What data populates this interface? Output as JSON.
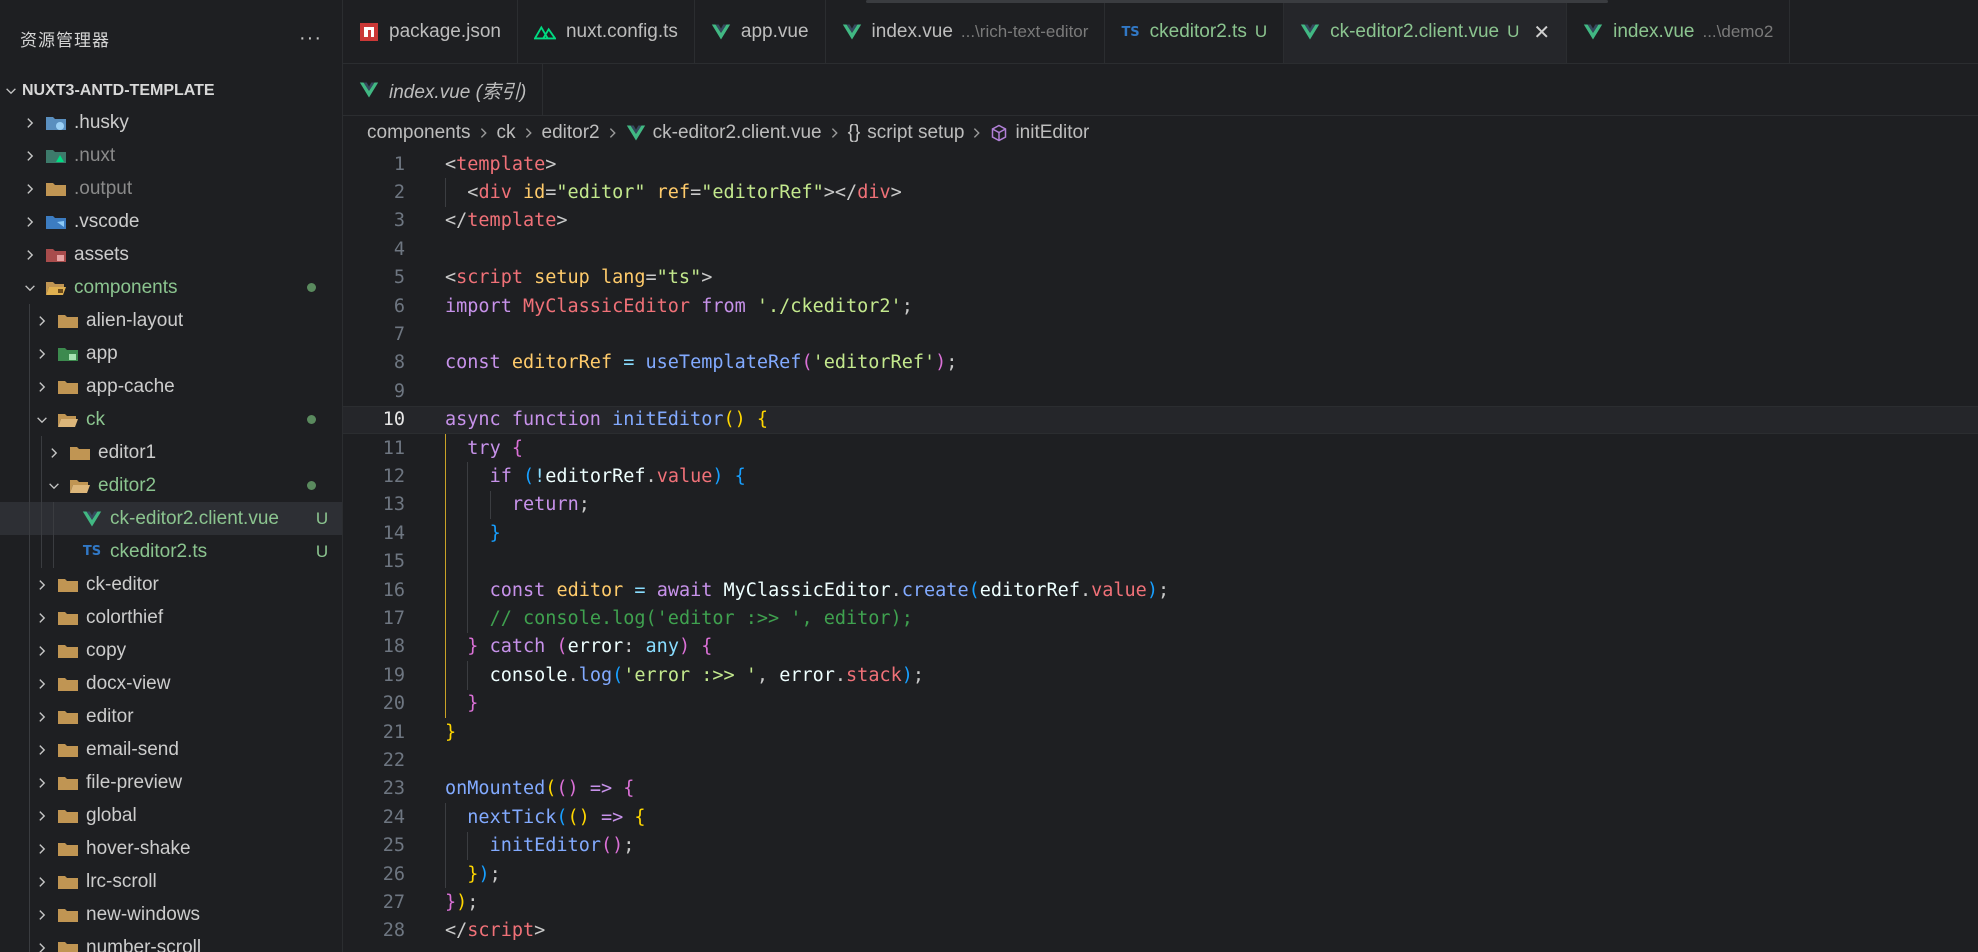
{
  "sidebar": {
    "title": "资源管理器",
    "more": "···",
    "project": "NUXT3-ANTD-TEMPLATE",
    "items": [
      {
        "label": ".husky",
        "depth": 0,
        "open": false,
        "icon": "husky-folder-icon",
        "style": ""
      },
      {
        "label": ".nuxt",
        "depth": 0,
        "open": false,
        "icon": "nuxt-folder-icon",
        "style": "dim"
      },
      {
        "label": ".output",
        "depth": 0,
        "open": false,
        "icon": "folder-icon",
        "style": "dim"
      },
      {
        "label": ".vscode",
        "depth": 0,
        "open": false,
        "icon": "vscode-folder-icon",
        "style": ""
      },
      {
        "label": "assets",
        "depth": 0,
        "open": false,
        "icon": "assets-folder-icon",
        "style": ""
      },
      {
        "label": "components",
        "depth": 0,
        "open": true,
        "icon": "components-folder-icon",
        "style": "git",
        "dot": true
      },
      {
        "label": "alien-layout",
        "depth": 1,
        "open": false,
        "icon": "folder-icon",
        "style": ""
      },
      {
        "label": "app",
        "depth": 1,
        "open": false,
        "icon": "app-folder-icon",
        "style": ""
      },
      {
        "label": "app-cache",
        "depth": 1,
        "open": false,
        "icon": "folder-icon",
        "style": ""
      },
      {
        "label": "ck",
        "depth": 1,
        "open": true,
        "icon": "folder-open-icon",
        "style": "git",
        "dot": true
      },
      {
        "label": "editor1",
        "depth": 2,
        "open": false,
        "icon": "folder-icon",
        "style": ""
      },
      {
        "label": "editor2",
        "depth": 2,
        "open": true,
        "icon": "folder-open-icon",
        "style": "git",
        "dot": true
      },
      {
        "label": "ck-editor2.client.vue",
        "depth": 3,
        "file": true,
        "icon": "vue-file-icon",
        "style": "git",
        "badge": "U",
        "selected": true
      },
      {
        "label": "ckeditor2.ts",
        "depth": 3,
        "file": true,
        "icon": "ts-file-icon",
        "style": "git",
        "badge": "U"
      },
      {
        "label": "ck-editor",
        "depth": 1,
        "open": false,
        "icon": "folder-icon",
        "style": ""
      },
      {
        "label": "colorthief",
        "depth": 1,
        "open": false,
        "icon": "folder-icon",
        "style": ""
      },
      {
        "label": "copy",
        "depth": 1,
        "open": false,
        "icon": "folder-icon",
        "style": ""
      },
      {
        "label": "docx-view",
        "depth": 1,
        "open": false,
        "icon": "folder-icon",
        "style": ""
      },
      {
        "label": "editor",
        "depth": 1,
        "open": false,
        "icon": "folder-icon",
        "style": ""
      },
      {
        "label": "email-send",
        "depth": 1,
        "open": false,
        "icon": "folder-icon",
        "style": ""
      },
      {
        "label": "file-preview",
        "depth": 1,
        "open": false,
        "icon": "folder-icon",
        "style": ""
      },
      {
        "label": "global",
        "depth": 1,
        "open": false,
        "icon": "folder-icon",
        "style": ""
      },
      {
        "label": "hover-shake",
        "depth": 1,
        "open": false,
        "icon": "folder-icon",
        "style": ""
      },
      {
        "label": "lrc-scroll",
        "depth": 1,
        "open": false,
        "icon": "folder-icon",
        "style": ""
      },
      {
        "label": "new-windows",
        "depth": 1,
        "open": false,
        "icon": "folder-icon",
        "style": ""
      },
      {
        "label": "number-scroll",
        "depth": 1,
        "open": false,
        "icon": "folder-icon",
        "style": ""
      }
    ]
  },
  "tabs": [
    {
      "label": "package.json",
      "icon": "npm-icon",
      "desc": "",
      "badge": "",
      "git": false
    },
    {
      "label": "nuxt.config.ts",
      "icon": "nuxt-icon",
      "desc": "",
      "badge": "",
      "git": false
    },
    {
      "label": "app.vue",
      "icon": "vue-file-icon",
      "desc": "",
      "badge": "",
      "git": false
    },
    {
      "label": "index.vue",
      "icon": "vue-file-icon",
      "desc": "...\\rich-text-editor",
      "badge": "",
      "git": false
    },
    {
      "label": "ckeditor2.ts",
      "icon": "ts-file-icon",
      "desc": "",
      "badge": "U",
      "git": true
    },
    {
      "label": "ck-editor2.client.vue",
      "icon": "vue-file-icon",
      "desc": "",
      "badge": "U",
      "git": true,
      "active": true,
      "close": "✕"
    },
    {
      "label": "index.vue",
      "icon": "vue-file-icon",
      "desc": "...\\demo2",
      "badge": "",
      "git": true
    }
  ],
  "tabs_row2": [
    {
      "label": "index.vue (索引)",
      "icon": "vue-file-icon"
    }
  ],
  "breadcrumb": [
    {
      "label": "components",
      "icon": ""
    },
    {
      "label": "ck",
      "icon": ""
    },
    {
      "label": "editor2",
      "icon": ""
    },
    {
      "label": "ck-editor2.client.vue",
      "icon": "vue-file-icon"
    },
    {
      "label": "script setup",
      "icon": "braces-icon",
      "icon_text": "{}"
    },
    {
      "label": "initEditor",
      "icon": "method-icon"
    }
  ],
  "editor": {
    "current_line": 10,
    "lines": [
      {
        "n": "1",
        "indent": 0,
        "tokens": [
          [
            "punc",
            "<"
          ],
          [
            "tag",
            "template"
          ],
          [
            "punc",
            ">"
          ]
        ]
      },
      {
        "n": "2",
        "indent": 1,
        "tokens": [
          [
            "punc",
            "<"
          ],
          [
            "tag",
            "div"
          ],
          [
            "plain",
            " "
          ],
          [
            "attr",
            "id"
          ],
          [
            "punc",
            "="
          ],
          [
            "str",
            "\"editor\""
          ],
          [
            "plain",
            " "
          ],
          [
            "attr",
            "ref"
          ],
          [
            "punc",
            "="
          ],
          [
            "str",
            "\"editorRef\""
          ],
          [
            "punc",
            "></"
          ],
          [
            "tag",
            "div"
          ],
          [
            "punc",
            ">"
          ]
        ]
      },
      {
        "n": "3",
        "indent": 0,
        "tokens": [
          [
            "punc",
            "</"
          ],
          [
            "tag",
            "template"
          ],
          [
            "punc",
            ">"
          ]
        ]
      },
      {
        "n": "4",
        "indent": 0,
        "tokens": []
      },
      {
        "n": "5",
        "indent": 0,
        "tokens": [
          [
            "punc",
            "<"
          ],
          [
            "tag",
            "script"
          ],
          [
            "plain",
            " "
          ],
          [
            "attr",
            "setup"
          ],
          [
            "plain",
            " "
          ],
          [
            "attr",
            "lang"
          ],
          [
            "punc",
            "="
          ],
          [
            "str",
            "\"ts\""
          ],
          [
            "punc",
            ">"
          ]
        ]
      },
      {
        "n": "6",
        "indent": 0,
        "tokens": [
          [
            "kw",
            "import"
          ],
          [
            "plain",
            " "
          ],
          [
            "cls",
            "MyClassicEditor"
          ],
          [
            "plain",
            " "
          ],
          [
            "kw",
            "from"
          ],
          [
            "plain",
            " "
          ],
          [
            "str",
            "'./ckeditor2'"
          ],
          [
            "punc",
            ";"
          ]
        ]
      },
      {
        "n": "7",
        "indent": 0,
        "tokens": []
      },
      {
        "n": "8",
        "indent": 0,
        "tokens": [
          [
            "kw",
            "const"
          ],
          [
            "plain",
            " "
          ],
          [
            "var",
            "editorRef"
          ],
          [
            "plain",
            " "
          ],
          [
            "op",
            "="
          ],
          [
            "plain",
            " "
          ],
          [
            "fn",
            "useTemplateRef"
          ],
          [
            "br2",
            "("
          ],
          [
            "str",
            "'editorRef'"
          ],
          [
            "br2",
            ")"
          ],
          [
            "punc",
            ";"
          ]
        ]
      },
      {
        "n": "9",
        "indent": 0,
        "tokens": []
      },
      {
        "n": "10",
        "indent": 0,
        "tokens": [
          [
            "kw",
            "async"
          ],
          [
            "plain",
            " "
          ],
          [
            "kw",
            "function"
          ],
          [
            "plain",
            " "
          ],
          [
            "fn",
            "initEditor"
          ],
          [
            "br1",
            "()"
          ],
          [
            "plain",
            " "
          ],
          [
            "br1",
            "{"
          ]
        ]
      },
      {
        "n": "11",
        "indent": 1,
        "tokens": [
          [
            "kw",
            "try"
          ],
          [
            "plain",
            " "
          ],
          [
            "br2",
            "{"
          ]
        ]
      },
      {
        "n": "12",
        "indent": 2,
        "tokens": [
          [
            "kw",
            "if"
          ],
          [
            "plain",
            " "
          ],
          [
            "br3",
            "("
          ],
          [
            "op",
            "!"
          ],
          [
            "plain",
            "editorRef"
          ],
          [
            "punc",
            "."
          ],
          [
            "prop",
            "value"
          ],
          [
            "br3",
            ")"
          ],
          [
            "plain",
            " "
          ],
          [
            "br3",
            "{"
          ]
        ]
      },
      {
        "n": "13",
        "indent": 3,
        "tokens": [
          [
            "kw",
            "return"
          ],
          [
            "punc",
            ";"
          ]
        ]
      },
      {
        "n": "14",
        "indent": 2,
        "tokens": [
          [
            "br3",
            "}"
          ]
        ]
      },
      {
        "n": "15",
        "indent": 0,
        "tokens": []
      },
      {
        "n": "16",
        "indent": 2,
        "tokens": [
          [
            "kw",
            "const"
          ],
          [
            "plain",
            " "
          ],
          [
            "var",
            "editor"
          ],
          [
            "plain",
            " "
          ],
          [
            "op",
            "="
          ],
          [
            "plain",
            " "
          ],
          [
            "kw",
            "await"
          ],
          [
            "plain",
            " "
          ],
          [
            "plain",
            "MyClassicEditor"
          ],
          [
            "punc",
            "."
          ],
          [
            "fn",
            "create"
          ],
          [
            "br3",
            "("
          ],
          [
            "plain",
            "editorRef"
          ],
          [
            "punc",
            "."
          ],
          [
            "prop",
            "value"
          ],
          [
            "br3",
            ")"
          ],
          [
            "punc",
            ";"
          ]
        ]
      },
      {
        "n": "17",
        "indent": 2,
        "tokens": [
          [
            "cmt",
            "// console.log('editor :>> ', editor);"
          ]
        ]
      },
      {
        "n": "18",
        "indent": 1,
        "tokens": [
          [
            "br2",
            "}"
          ],
          [
            "plain",
            " "
          ],
          [
            "kw",
            "catch"
          ],
          [
            "plain",
            " "
          ],
          [
            "br2",
            "("
          ],
          [
            "plain",
            "error"
          ],
          [
            "punc",
            ": "
          ],
          [
            "type",
            "any"
          ],
          [
            "br2",
            ")"
          ],
          [
            "plain",
            " "
          ],
          [
            "br2",
            "{"
          ]
        ]
      },
      {
        "n": "19",
        "indent": 2,
        "tokens": [
          [
            "plain",
            "console"
          ],
          [
            "punc",
            "."
          ],
          [
            "fn",
            "log"
          ],
          [
            "br3",
            "("
          ],
          [
            "str",
            "'error :>> '"
          ],
          [
            "punc",
            ", "
          ],
          [
            "plain",
            "error"
          ],
          [
            "punc",
            "."
          ],
          [
            "prop",
            "stack"
          ],
          [
            "br3",
            ")"
          ],
          [
            "punc",
            ";"
          ]
        ]
      },
      {
        "n": "20",
        "indent": 1,
        "tokens": [
          [
            "br2",
            "}"
          ]
        ]
      },
      {
        "n": "21",
        "indent": 0,
        "tokens": [
          [
            "br1",
            "}"
          ]
        ]
      },
      {
        "n": "22",
        "indent": 0,
        "tokens": []
      },
      {
        "n": "23",
        "indent": 0,
        "tokens": [
          [
            "fn",
            "onMounted"
          ],
          [
            "br1",
            "("
          ],
          [
            "br2",
            "()"
          ],
          [
            "plain",
            " "
          ],
          [
            "kw",
            "=>"
          ],
          [
            "plain",
            " "
          ],
          [
            "br2",
            "{"
          ]
        ]
      },
      {
        "n": "24",
        "indent": 1,
        "tokens": [
          [
            "fn",
            "nextTick"
          ],
          [
            "br3",
            "("
          ],
          [
            "br1",
            "()"
          ],
          [
            "plain",
            " "
          ],
          [
            "kw",
            "=>"
          ],
          [
            "plain",
            " "
          ],
          [
            "br1",
            "{"
          ]
        ]
      },
      {
        "n": "25",
        "indent": 2,
        "tokens": [
          [
            "fn",
            "initEditor"
          ],
          [
            "br2",
            "()"
          ],
          [
            "punc",
            ";"
          ]
        ]
      },
      {
        "n": "26",
        "indent": 1,
        "tokens": [
          [
            "br1",
            "}"
          ],
          [
            "br3",
            ")"
          ],
          [
            "punc",
            ";"
          ]
        ]
      },
      {
        "n": "27",
        "indent": 0,
        "tokens": [
          [
            "br2",
            "}"
          ],
          [
            "br1",
            ")"
          ],
          [
            "punc",
            ";"
          ]
        ]
      },
      {
        "n": "28",
        "indent": 0,
        "tokens": [
          [
            "punc",
            "</"
          ],
          [
            "tag",
            "script"
          ],
          [
            "punc",
            ">"
          ]
        ]
      }
    ]
  },
  "colors": {
    "git_added": "#8bc48f",
    "vue": "#41b883",
    "ts": "#3178c6",
    "folder": "#c09553",
    "active_guide": "#c9a227"
  }
}
